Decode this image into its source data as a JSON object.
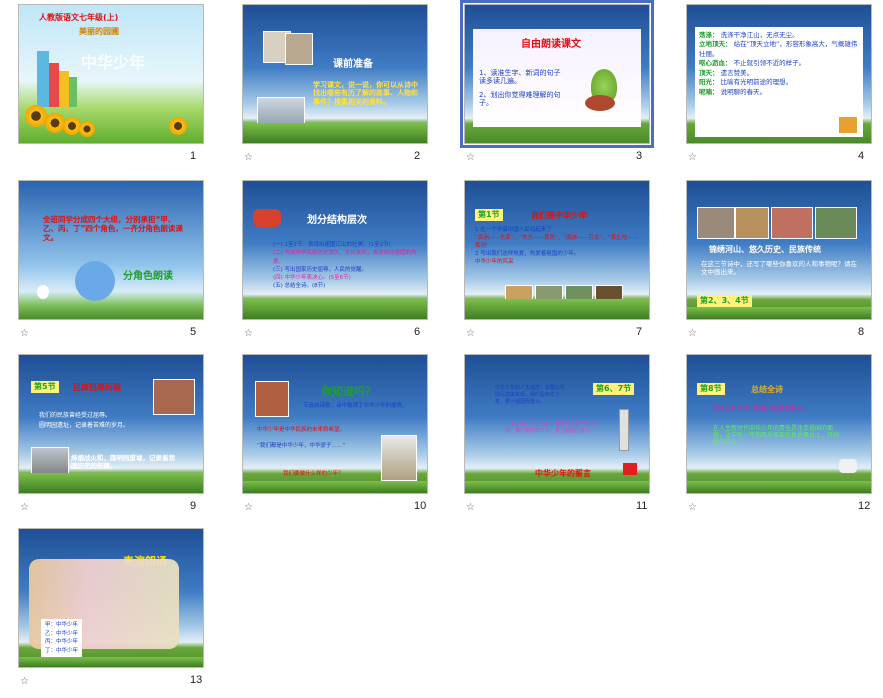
{
  "slides": [
    {
      "num": "1",
      "title_line1": "人教版语文七年级(上)",
      "title_line2": "美丽的园圃",
      "title_big": "中华少年"
    },
    {
      "num": "2",
      "title": "课前准备",
      "body": "学习课文，说一说，你可以从诗中找出哪些有历了解的故事、人物和事件？搜集相关的资料。"
    },
    {
      "num": "3",
      "title": "自由朗读课文",
      "items": [
        "1、读准生字、新词的句子读多读几遍。",
        "2、划出你觉得难理解的句子。"
      ]
    },
    {
      "num": "4",
      "rows": [
        [
          "荡涤：",
          "洗涤干净江山，无点无尘。"
        ],
        [
          "立地顶天：",
          "站在“顶天立地”，形容形象高大，气概雄伟壮丽。"
        ],
        [
          "呕心沥血：",
          "不止就引领不近的样子。"
        ],
        [
          "顶天：",
          "遗言赞美。"
        ],
        [
          "阳光：",
          "比喻有光明前途的理想。"
        ],
        [
          "呢喃：",
          "说明聊的春天。"
        ]
      ]
    },
    {
      "num": "5",
      "body": "全班同学分成四个大组，分别承担“甲、乙、丙、丁”四个角色，一齐分角色朗读课文。",
      "label": "分角色朗读"
    },
    {
      "num": "6",
      "title": "划分结构层次",
      "items": [
        "(一) 1至2节：表现出祖国江山的壮美。(1至2节)",
        "(二) 写出中华民族历史悠久、文化灿烂，表达出对祖国的热爱。",
        "(三) 写出国家历史屈辱，人民的觉醒。",
        "(四) 中华少年表决心。(5至6节)",
        "(五) 总结全诗。(8节)"
      ]
    },
    {
      "num": "7",
      "tag": "第1节",
      "title": "我们是中华少年",
      "items": [
        "1 在一个早晨中国人民站起来了",
        "“亚洲——东亚”、“东方——黄色”、“南岸——巨龙”、“黄土地——黄河”",
        "2 写出我们这样热爱，热爱着祖国的少年。",
        "中华少年的风采"
      ]
    },
    {
      "num": "8",
      "caption": "锦绣河山、悠久历史、民族传统",
      "body": "在这三节诗中，还写了哪些你喜欢的人和事物呢？请在文中画出来。",
      "tag": "第2、3、4节"
    },
    {
      "num": "9",
      "tag": "第5节",
      "title": "民族屈辱历程",
      "lines": [
        "我们的民族曾经受过屈辱。",
        "圆明园遗址，记录着苦难的岁月。"
      ],
      "body": "烽烟战火和，圆明园废墟，记录着我国历史的伤痛。"
    },
    {
      "num": "10",
      "title": "你知道吗？",
      "body": "节选自诗歌，诗中歌颂了中华少年的豪情。",
      "notes": [
        "中华少年是中华民族的未来和希望。",
        "“我们都是中华少年，中华骄子……”",
        "我们要做什么样的少年？"
      ]
    },
    {
      "num": "11",
      "tag": "第6、7节",
      "body": "中华少年的人生信念，需要以实际行动来实现，我们是中华少年，要为祖国而奋斗。",
      "footer": "中华少年的誓言"
    },
    {
      "num": "12",
      "tag": "第8节",
      "title": "总结全诗",
      "items": [
        "你对这首诗中的哪些内容体会最深？",
        "在人生新时代中华少年的责任是改变祖国的面貌，让中华少年的风采展现在世界舞台上，开创新的未来。"
      ]
    },
    {
      "num": "13",
      "title": "表演朗诵",
      "items": [
        "甲：中华少年",
        "乙：中华少年",
        "丙：中华少年",
        "丁：中华少年"
      ]
    }
  ],
  "star_glyph": "☆"
}
